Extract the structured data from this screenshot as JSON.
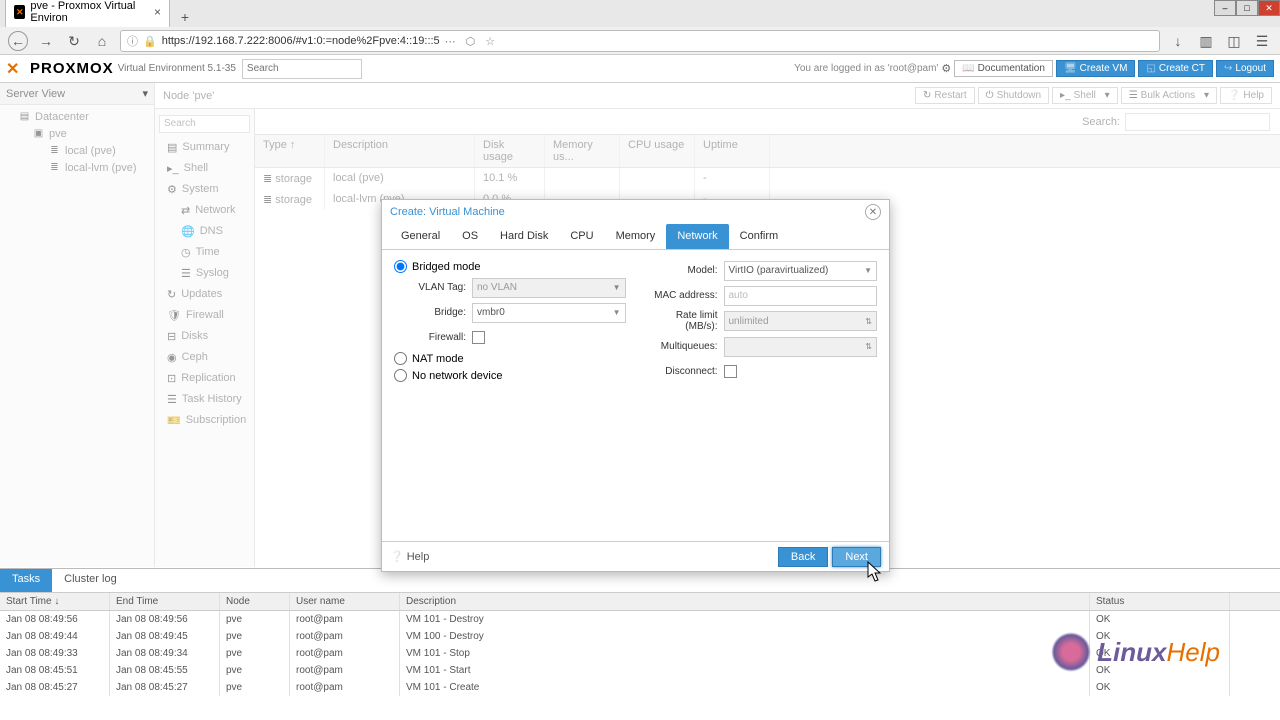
{
  "browser": {
    "tab_title": "pve - Proxmox Virtual Environ",
    "url": "https://192.168.7.222:8006/#v1:0:=node%2Fpve:4::19:::5"
  },
  "header": {
    "logo_text": "PROXMOX",
    "version": "Virtual Environment 5.1-35",
    "search_placeholder": "Search",
    "login_text": "You are logged in as 'root@pam'",
    "doc": "Documentation",
    "create_vm": "Create VM",
    "create_ct": "Create CT",
    "logout": "Logout"
  },
  "sidebar": {
    "title": "Server View",
    "items": [
      "Datacenter",
      "pve",
      "local (pve)",
      "local-lvm (pve)"
    ]
  },
  "node": {
    "breadcrumb": "Node 'pve'",
    "actions": {
      "restart": "Restart",
      "shutdown": "Shutdown",
      "shell": "Shell",
      "bulk": "Bulk Actions",
      "help": "Help"
    },
    "search_label": "Search:"
  },
  "nav": {
    "search_placeholder": "Search",
    "items": [
      "Summary",
      "Shell",
      "System",
      "Network",
      "DNS",
      "Time",
      "Syslog",
      "Updates",
      "Firewall",
      "Disks",
      "Ceph",
      "Replication",
      "Task History",
      "Subscription"
    ]
  },
  "grid": {
    "cols": {
      "type": "Type ↑",
      "desc": "Description",
      "disk": "Disk usage",
      "mem": "Memory us...",
      "cpu": "CPU usage",
      "up": "Uptime"
    },
    "rows": [
      {
        "type": "storage",
        "desc": "local (pve)",
        "disk": "10.1 %",
        "mem": "",
        "cpu": "",
        "up": "-"
      },
      {
        "type": "storage",
        "desc": "local-lvm (pve)",
        "disk": "0.0 %",
        "mem": "",
        "cpu": "",
        "up": "-"
      }
    ]
  },
  "modal": {
    "title": "Create: Virtual Machine",
    "tabs": [
      "General",
      "OS",
      "Hard Disk",
      "CPU",
      "Memory",
      "Network",
      "Confirm"
    ],
    "active_tab": "Network",
    "radios": {
      "bridged": "Bridged mode",
      "nat": "NAT mode",
      "none": "No network device"
    },
    "left": {
      "vlan_label": "VLAN Tag:",
      "vlan_value": "no VLAN",
      "bridge_label": "Bridge:",
      "bridge_value": "vmbr0",
      "firewall_label": "Firewall:"
    },
    "right": {
      "model_label": "Model:",
      "model_value": "VirtIO (paravirtualized)",
      "mac_label": "MAC address:",
      "mac_value": "auto",
      "rate_label": "Rate limit (MB/s):",
      "rate_value": "unlimited",
      "mq_label": "Multiqueues:",
      "mq_value": "",
      "disc_label": "Disconnect:"
    },
    "footer": {
      "help": "Help",
      "back": "Back",
      "next": "Next"
    }
  },
  "tasks": {
    "tabs": {
      "tasks": "Tasks",
      "cluster": "Cluster log"
    },
    "cols": {
      "start": "Start Time ↓",
      "end": "End Time",
      "node": "Node",
      "user": "User name",
      "desc": "Description",
      "status": "Status"
    },
    "rows": [
      {
        "start": "Jan 08 08:49:56",
        "end": "Jan 08 08:49:56",
        "node": "pve",
        "user": "root@pam",
        "desc": "VM 101 - Destroy",
        "status": "OK"
      },
      {
        "start": "Jan 08 08:49:44",
        "end": "Jan 08 08:49:45",
        "node": "pve",
        "user": "root@pam",
        "desc": "VM 100 - Destroy",
        "status": "OK"
      },
      {
        "start": "Jan 08 08:49:33",
        "end": "Jan 08 08:49:34",
        "node": "pve",
        "user": "root@pam",
        "desc": "VM 101 - Stop",
        "status": "OK"
      },
      {
        "start": "Jan 08 08:45:51",
        "end": "Jan 08 08:45:55",
        "node": "pve",
        "user": "root@pam",
        "desc": "VM 101 - Start",
        "status": "OK"
      },
      {
        "start": "Jan 08 08:45:27",
        "end": "Jan 08 08:45:27",
        "node": "pve",
        "user": "root@pam",
        "desc": "VM 101 - Create",
        "status": "OK"
      }
    ]
  },
  "watermark": {
    "text1": "Linux",
    "text2": "Help"
  }
}
